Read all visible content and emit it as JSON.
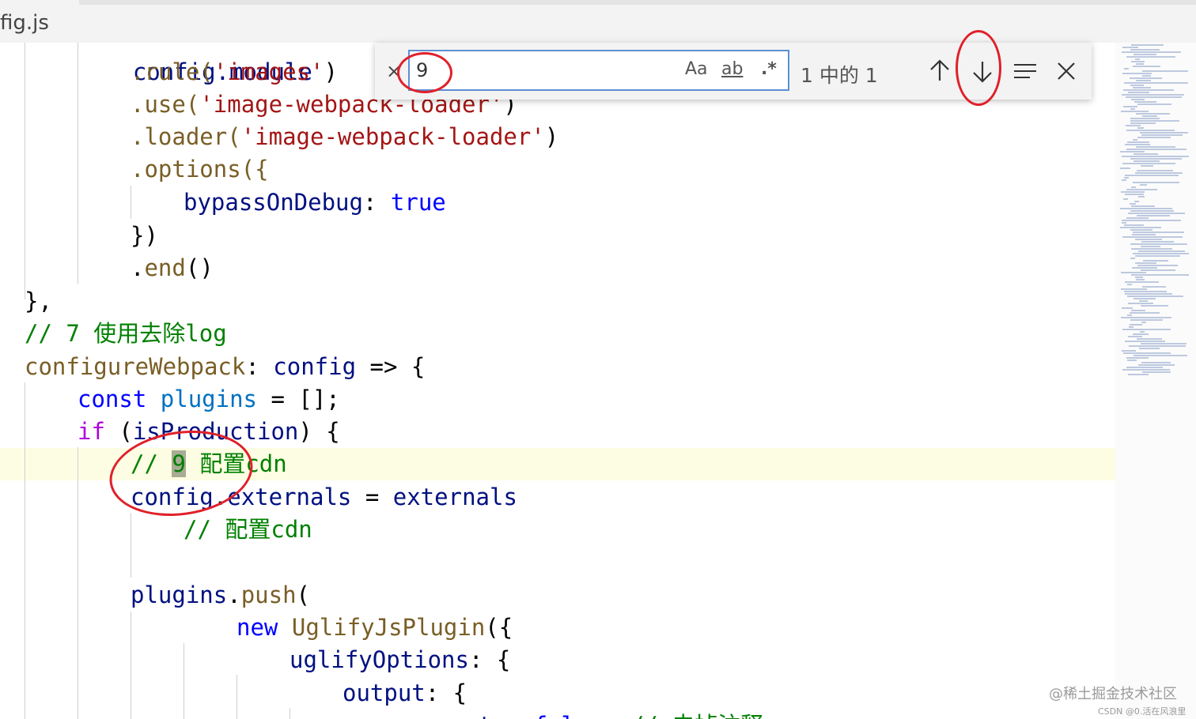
{
  "tab": {
    "title": "fig.js"
  },
  "find": {
    "query": "9",
    "match_case_label": "Aa",
    "whole_word_label": "ab",
    "regex_label": ".*",
    "count": "1 中的 1"
  },
  "code": {
    "l0": "config.module",
    "l1": [
      ".rule(",
      "'images'",
      ")"
    ],
    "l2": [
      ".use(",
      "'image-webpack-loader'",
      ")"
    ],
    "l3": [
      ".loader(",
      "'image-webpack-loader'",
      ")"
    ],
    "l4": ".options({",
    "l5": [
      "bypassOnDebug",
      ": ",
      "true"
    ],
    "l6": "})",
    "l7": [
      ".",
      "end",
      "()"
    ],
    "l8": "},",
    "l9": "// 7 使用去除log",
    "l10": [
      "configureWebpack",
      ": ",
      "config",
      " => {"
    ],
    "l11": [
      "const",
      " ",
      "plugins",
      " = [];"
    ],
    "l12": [
      "if",
      " (",
      "isProduction",
      ") {"
    ],
    "l13": [
      "// ",
      "9",
      " 配置cdn"
    ],
    "l14": [
      "config",
      ".",
      "externals",
      " = ",
      "externals"
    ],
    "l15": "// 配置cdn",
    "l17": [
      "plugins",
      ".",
      "push",
      "("
    ],
    "l18": [
      "new",
      " ",
      "UglifyJsPlugin",
      "({"
    ],
    "l19": [
      "uglifyOptions",
      ": {"
    ],
    "l20": [
      "output",
      ": {"
    ],
    "l21": [
      "comments",
      ": ",
      "false",
      ", ",
      "// 去掉注释"
    ]
  },
  "watermark": {
    "line1": "@稀土掘金技术社区",
    "line2": "CSDN @0.活在风浪里"
  },
  "colors": {
    "annotation": "#e0202a",
    "find_border": "#5b8fd4"
  }
}
